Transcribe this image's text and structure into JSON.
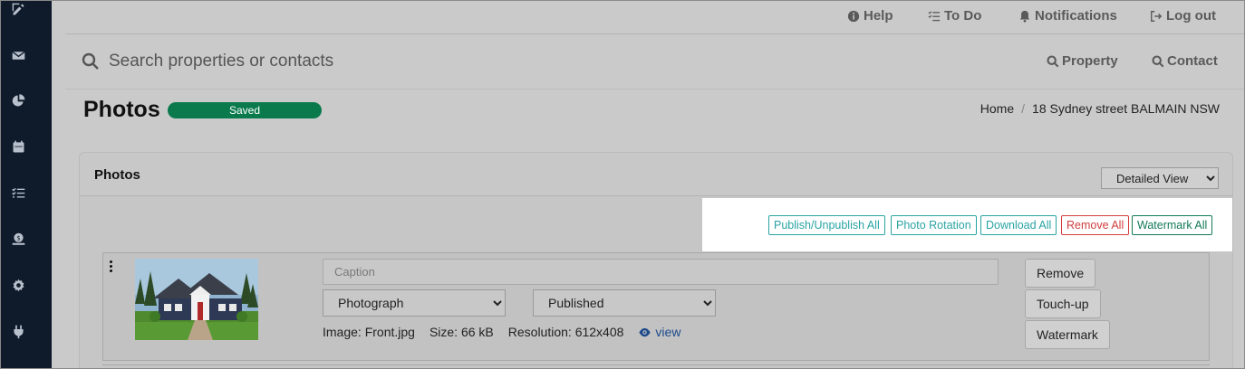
{
  "topbar": {
    "help": "Help",
    "todo": "To Do",
    "notifications": "Notifications",
    "logout": "Log out"
  },
  "search": {
    "placeholder": "Search properties or contacts",
    "property": "Property",
    "contact": "Contact"
  },
  "page": {
    "title": "Photos",
    "status": "Saved"
  },
  "breadcrumb": [
    "Home",
    "18 Sydney street BALMAIN NSW"
  ],
  "card": {
    "title": "Photos",
    "view_selected": "Detailed View",
    "actions": {
      "publish_all": "Publish/Unpublish All",
      "rotation": "Photo Rotation",
      "download_all": "Download All",
      "remove_all": "Remove All",
      "watermark_all": "Watermark All"
    }
  },
  "photo": {
    "caption_placeholder": "Caption",
    "type_selected": "Photograph",
    "publish_selected": "Published",
    "image_label": "Image: Front.jpg",
    "size_label": "Size: 66 kB",
    "resolution_label": "Resolution: 612x408",
    "view_label": "view",
    "buttons": {
      "remove": "Remove",
      "touchup": "Touch-up",
      "watermark": "Watermark"
    }
  },
  "colors": {
    "sidebar": "#0f1a2b",
    "saved_badge": "#0a7a4d",
    "teal": "#2aa3a3",
    "red": "#d23c3c",
    "link": "#1d4a8c"
  },
  "icons": {
    "sidebar": [
      "edit-icon",
      "mail-icon",
      "pie-chart-icon",
      "calendar-icon",
      "checklist-icon",
      "money-icon",
      "gear-icon",
      "plug-icon"
    ]
  }
}
